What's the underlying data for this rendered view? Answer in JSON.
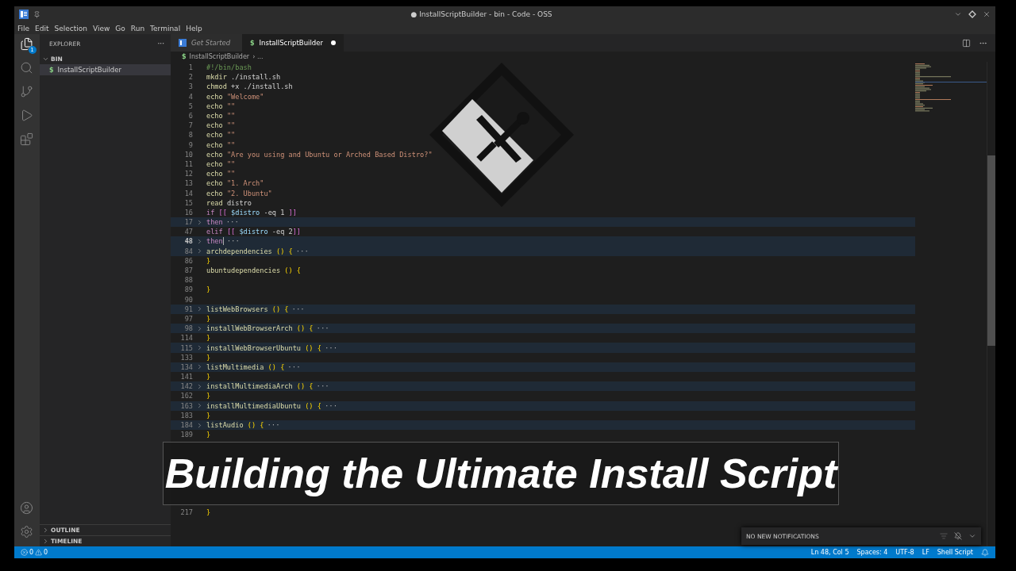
{
  "window": {
    "title": "● InstallScriptBuilder - bin - Code - OSS"
  },
  "menu": [
    "File",
    "Edit",
    "Selection",
    "View",
    "Go",
    "Run",
    "Terminal",
    "Help"
  ],
  "activity_bar": {
    "explorer_badge": "1"
  },
  "sidebar": {
    "title": "EXPLORER",
    "more": "···",
    "folder": {
      "label": "BIN",
      "expanded": true,
      "files": [
        {
          "label": "InstallScriptBuilder",
          "icon": "$",
          "selected": true
        }
      ]
    },
    "sections": [
      {
        "label": "OUTLINE",
        "expanded": false
      },
      {
        "label": "TIMELINE",
        "expanded": false
      }
    ]
  },
  "tabs": [
    {
      "label": "Get Started",
      "kind": "welcome",
      "selected": false,
      "modified": false
    },
    {
      "label": "InstallScriptBuilder",
      "kind": "shell",
      "icon": "$",
      "selected": true,
      "modified": true
    }
  ],
  "breadcrumb": {
    "icon": "$",
    "file": "InstallScriptBuilder",
    "rest": "› ..."
  },
  "fold_marker": "···",
  "lines": [
    {
      "number": "1",
      "folded": false,
      "current": false,
      "segments": [
        {
          "kind": "comment",
          "text": "#!/bin/bash"
        }
      ]
    },
    {
      "number": "2",
      "folded": false,
      "current": false,
      "segments": [
        {
          "kind": "command",
          "text": "mkdir"
        },
        {
          "kind": "plain",
          "text": " ./install.sh"
        }
      ]
    },
    {
      "number": "3",
      "folded": false,
      "current": false,
      "segments": [
        {
          "kind": "command",
          "text": "chmod"
        },
        {
          "kind": "plain",
          "text": " +x ./install.sh"
        }
      ]
    },
    {
      "number": "4",
      "folded": false,
      "current": false,
      "segments": [
        {
          "kind": "command",
          "text": "echo"
        },
        {
          "kind": "string",
          "text": " \"Welcome\""
        }
      ]
    },
    {
      "number": "5",
      "folded": false,
      "current": false,
      "segments": [
        {
          "kind": "command",
          "text": "echo"
        },
        {
          "kind": "string",
          "text": " \"\""
        }
      ]
    },
    {
      "number": "6",
      "folded": false,
      "current": false,
      "segments": [
        {
          "kind": "command",
          "text": "echo"
        },
        {
          "kind": "string",
          "text": " \"\""
        }
      ]
    },
    {
      "number": "7",
      "folded": false,
      "current": false,
      "segments": [
        {
          "kind": "command",
          "text": "echo"
        },
        {
          "kind": "string",
          "text": " \"\""
        }
      ]
    },
    {
      "number": "8",
      "folded": false,
      "current": false,
      "segments": [
        {
          "kind": "command",
          "text": "echo"
        },
        {
          "kind": "string",
          "text": " \"\""
        }
      ]
    },
    {
      "number": "9",
      "folded": false,
      "current": false,
      "segments": [
        {
          "kind": "command",
          "text": "echo"
        },
        {
          "kind": "string",
          "text": " \"\""
        }
      ]
    },
    {
      "number": "10",
      "folded": false,
      "current": false,
      "segments": [
        {
          "kind": "command",
          "text": "echo"
        },
        {
          "kind": "string",
          "text": " \"Are you using and Ubuntu or Arched Based Distro?\""
        }
      ]
    },
    {
      "number": "11",
      "folded": false,
      "current": false,
      "segments": [
        {
          "kind": "command",
          "text": "echo"
        },
        {
          "kind": "string",
          "text": " \"\""
        }
      ]
    },
    {
      "number": "12",
      "folded": false,
      "current": false,
      "segments": [
        {
          "kind": "command",
          "text": "echo"
        },
        {
          "kind": "string",
          "text": " \"\""
        }
      ]
    },
    {
      "number": "13",
      "folded": false,
      "current": false,
      "segments": [
        {
          "kind": "command",
          "text": "echo"
        },
        {
          "kind": "string",
          "text": " \"1. Arch\""
        }
      ]
    },
    {
      "number": "14",
      "folded": false,
      "current": false,
      "segments": [
        {
          "kind": "command",
          "text": "echo"
        },
        {
          "kind": "string",
          "text": " \"2. Ubuntu\""
        }
      ]
    },
    {
      "number": "15",
      "folded": false,
      "current": false,
      "segments": [
        {
          "kind": "command",
          "text": "read"
        },
        {
          "kind": "plain",
          "text": " distro"
        }
      ]
    },
    {
      "number": "16",
      "folded": false,
      "current": false,
      "segments": [
        {
          "kind": "keyword",
          "text": "if"
        },
        {
          "kind": "bracket",
          "text": " [["
        },
        {
          "kind": "variable",
          "text": " $distro"
        },
        {
          "kind": "plain",
          "text": " -eq 1 "
        },
        {
          "kind": "bracket",
          "text": "]]"
        }
      ]
    },
    {
      "number": "17",
      "folded": true,
      "current": false,
      "segments": [
        {
          "kind": "keyword",
          "text": "then"
        }
      ]
    },
    {
      "number": "47",
      "folded": false,
      "current": false,
      "segments": [
        {
          "kind": "keyword",
          "text": "elif"
        },
        {
          "kind": "bracket",
          "text": " [["
        },
        {
          "kind": "variable",
          "text": " $distro"
        },
        {
          "kind": "plain",
          "text": " -eq 2"
        },
        {
          "kind": "bracket",
          "text": "]]"
        }
      ]
    },
    {
      "number": "48",
      "folded": true,
      "current": true,
      "segments": [
        {
          "kind": "keyword",
          "text": "then"
        }
      ]
    },
    {
      "number": "84",
      "folded": true,
      "current": false,
      "segments": [
        {
          "kind": "function",
          "text": "archdependencies"
        },
        {
          "kind": "brace",
          "text": " () {"
        }
      ]
    },
    {
      "number": "86",
      "folded": false,
      "current": false,
      "segments": [
        {
          "kind": "brace",
          "text": "}"
        }
      ]
    },
    {
      "number": "87",
      "folded": false,
      "current": false,
      "segments": [
        {
          "kind": "function",
          "text": "ubuntudependencies"
        },
        {
          "kind": "brace",
          "text": " () {"
        }
      ]
    },
    {
      "number": "88",
      "folded": false,
      "current": false
    },
    {
      "number": "89",
      "folded": false,
      "current": false,
      "segments": [
        {
          "kind": "brace",
          "text": "}"
        }
      ]
    },
    {
      "number": "90",
      "folded": false,
      "current": false
    },
    {
      "number": "91",
      "folded": true,
      "current": false,
      "segments": [
        {
          "kind": "function",
          "text": "listWebBrowsers"
        },
        {
          "kind": "brace",
          "text": " () {"
        }
      ]
    },
    {
      "number": "97",
      "folded": false,
      "current": false,
      "segments": [
        {
          "kind": "brace",
          "text": "}"
        }
      ]
    },
    {
      "number": "98",
      "folded": true,
      "current": false,
      "segments": [
        {
          "kind": "function",
          "text": "installWebBrowserArch"
        },
        {
          "kind": "brace",
          "text": " () {"
        }
      ]
    },
    {
      "number": "114",
      "folded": false,
      "current": false,
      "segments": [
        {
          "kind": "brace",
          "text": "}"
        }
      ]
    },
    {
      "number": "115",
      "folded": true,
      "current": false,
      "segments": [
        {
          "kind": "function",
          "text": "installWebBrowserUbuntu"
        },
        {
          "kind": "brace",
          "text": " () {"
        }
      ]
    },
    {
      "number": "133",
      "folded": false,
      "current": false,
      "segments": [
        {
          "kind": "brace",
          "text": "}"
        }
      ]
    },
    {
      "number": "134",
      "folded": true,
      "current": false,
      "segments": [
        {
          "kind": "function",
          "text": "listMultimedia"
        },
        {
          "kind": "brace",
          "text": " () {"
        }
      ]
    },
    {
      "number": "141",
      "folded": false,
      "current": false,
      "segments": [
        {
          "kind": "brace",
          "text": "}"
        }
      ]
    },
    {
      "number": "142",
      "folded": true,
      "current": false,
      "segments": [
        {
          "kind": "function",
          "text": "installMultimediaArch"
        },
        {
          "kind": "brace",
          "text": " () {"
        }
      ]
    },
    {
      "number": "162",
      "folded": false,
      "current": false,
      "segments": [
        {
          "kind": "brace",
          "text": "}"
        }
      ]
    },
    {
      "number": "163",
      "folded": true,
      "current": false,
      "segments": [
        {
          "kind": "function",
          "text": "installMultimediaUbuntu"
        },
        {
          "kind": "brace",
          "text": " () {"
        }
      ]
    },
    {
      "number": "183",
      "folded": false,
      "current": false,
      "segments": [
        {
          "kind": "brace",
          "text": "}"
        }
      ]
    },
    {
      "number": "184",
      "folded": true,
      "current": false,
      "segments": [
        {
          "kind": "function",
          "text": "listAudio"
        },
        {
          "kind": "brace",
          "text": " () {"
        }
      ]
    },
    {
      "number": "189",
      "folded": false,
      "current": false,
      "segments": [
        {
          "kind": "brace",
          "text": "}"
        }
      ]
    }
  ],
  "banner": {
    "title": "Building the Ultimate Install Script"
  },
  "lines_after_banner": [
    {
      "number": "217",
      "folded": false,
      "current": false,
      "segments": [
        {
          "kind": "brace",
          "text": "}"
        }
      ]
    }
  ],
  "notifications": {
    "message": "NO NEW NOTIFICATIONS"
  },
  "status_bar": {
    "errors": "0",
    "warnings": "0",
    "right": [
      "Ln 48, Col 5",
      "Spaces: 4",
      "UTF-8",
      "LF",
      "Shell Script"
    ]
  }
}
